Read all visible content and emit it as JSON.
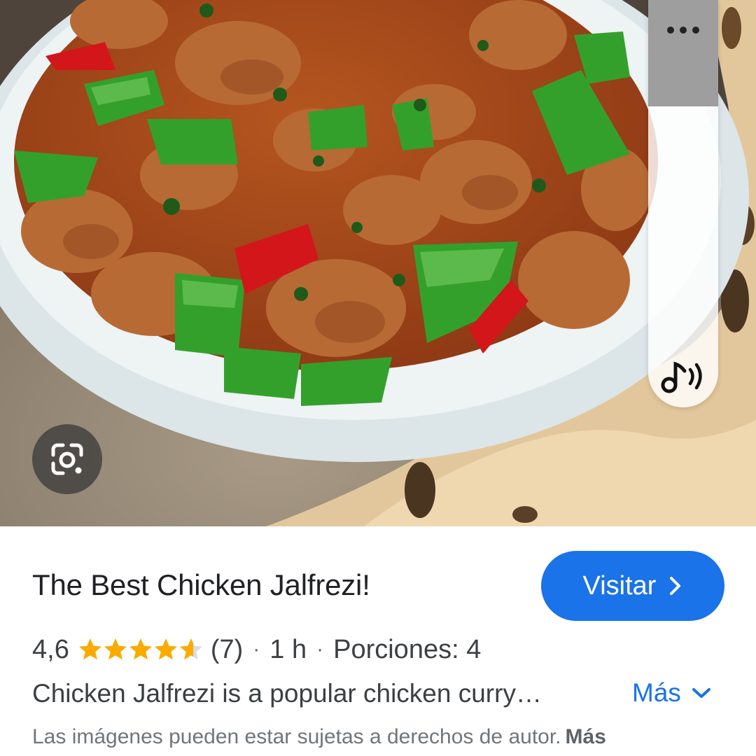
{
  "photo": {
    "alt_icon": "food-photo",
    "colors": {
      "sauce": "#a24a1e",
      "chicken": "#b5642e",
      "green_pepper": "#2f9a2a",
      "red_pepper": "#d11b1b",
      "bowl": "#dfe7ea",
      "naan": "#e2c69a",
      "plate": "#8c8171"
    }
  },
  "lens_button": {
    "icon": "google-lens-icon"
  },
  "side_panel": {
    "menu_icon": "more-horizontal-icon",
    "sound_icon": "music-note-sound-icon"
  },
  "card": {
    "title": "The Best Chicken Jalfrezi!",
    "visit_label": "Visitar",
    "visit_icon": "chevron-right-icon",
    "rating": "4,6",
    "rating_value": 4.6,
    "rating_max": 5,
    "review_count": "(7)",
    "separator": "·",
    "duration": "1 h",
    "servings": "Porciones: 4",
    "description": "Chicken Jalfrezi is a popular chicken curry…",
    "more_label": "Más",
    "more_icon": "chevron-down-icon",
    "copyright_text": "Las imágenes pueden estar sujetas a derechos de autor.",
    "copyright_more": "Más",
    "accent_color": "#1a73e8",
    "star_color": "#f9ab00"
  }
}
